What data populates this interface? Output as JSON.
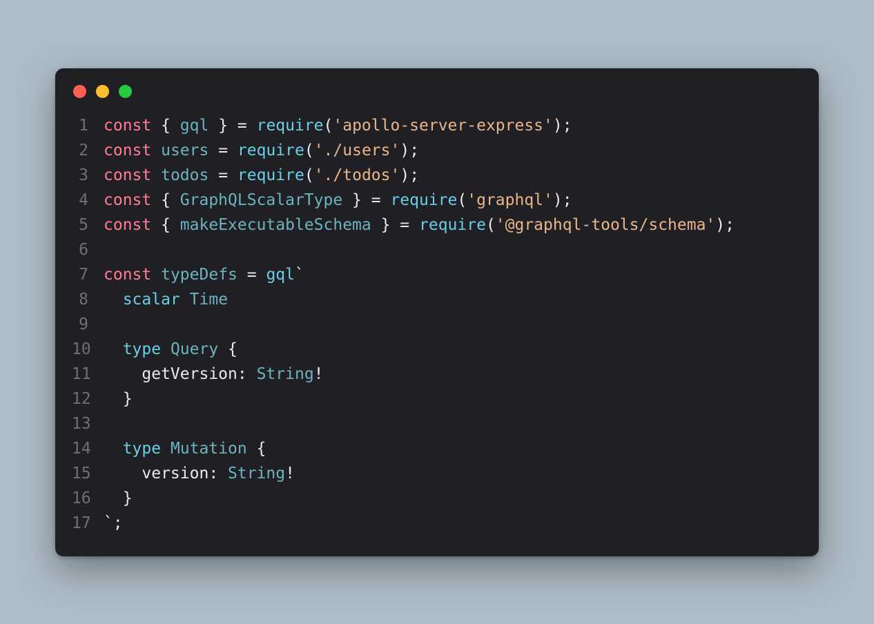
{
  "window": {
    "traffic": {
      "close": "close",
      "minimize": "minimize",
      "zoom": "zoom"
    }
  },
  "code": {
    "l1": {
      "kw": "const",
      "brace_o": " { ",
      "ident": "gql",
      "brace_c": " } ",
      "eq": "= ",
      "fn": "require",
      "paren_o": "(",
      "str": "'apollo-server-express'",
      "paren_c": ")",
      "semi": ";"
    },
    "l2": {
      "kw": "const",
      "sp": " ",
      "ident": "users",
      "eq": " = ",
      "fn": "require",
      "paren_o": "(",
      "str": "'./users'",
      "paren_c": ")",
      "semi": ";"
    },
    "l3": {
      "kw": "const",
      "sp": " ",
      "ident": "todos",
      "eq": " = ",
      "fn": "require",
      "paren_o": "(",
      "str": "'./todos'",
      "paren_c": ")",
      "semi": ";"
    },
    "l4": {
      "kw": "const",
      "brace_o": " { ",
      "ident": "GraphQLScalarType",
      "brace_c": " } ",
      "eq": "= ",
      "fn": "require",
      "paren_o": "(",
      "str": "'graphql'",
      "paren_c": ")",
      "semi": ";"
    },
    "l5": {
      "kw": "const",
      "brace_o": " { ",
      "ident": "makeExecutableSchema",
      "brace_c": " } ",
      "eq": "= ",
      "fn": "require",
      "paren_o": "(",
      "str": "'@graphql-tools/schema'",
      "paren_c": ")",
      "semi": ";"
    },
    "l6": {
      "blank": ""
    },
    "l7": {
      "kw": "const",
      "sp": " ",
      "ident": "typeDefs",
      "eq": " = ",
      "fn": "gql",
      "tick": "`"
    },
    "l8": {
      "indent": "  ",
      "kw": "scalar",
      "sp": " ",
      "type": "Time"
    },
    "l9": {
      "blank": ""
    },
    "l10": {
      "indent": "  ",
      "kw": "type",
      "sp": " ",
      "type": "Query",
      "brace": " {"
    },
    "l11": {
      "indent": "    ",
      "field": "getVersion",
      "colon": ": ",
      "rtype": "String",
      "bang": "!"
    },
    "l12": {
      "indent": "  ",
      "brace": "}"
    },
    "l13": {
      "blank": ""
    },
    "l14": {
      "indent": "  ",
      "kw": "type",
      "sp": " ",
      "type": "Mutation",
      "brace": " {"
    },
    "l15": {
      "indent": "    ",
      "field": "version",
      "colon": ": ",
      "rtype": "String",
      "bang": "!"
    },
    "l16": {
      "indent": "  ",
      "brace": "}"
    },
    "l17": {
      "tick": "`",
      "semi": ";"
    }
  },
  "line_numbers": {
    "n1": "1",
    "n2": "2",
    "n3": "3",
    "n4": "4",
    "n5": "5",
    "n6": "6",
    "n7": "7",
    "n8": "8",
    "n9": "9",
    "n10": "10",
    "n11": "11",
    "n12": "12",
    "n13": "13",
    "n14": "14",
    "n15": "15",
    "n16": "16",
    "n17": "17"
  }
}
